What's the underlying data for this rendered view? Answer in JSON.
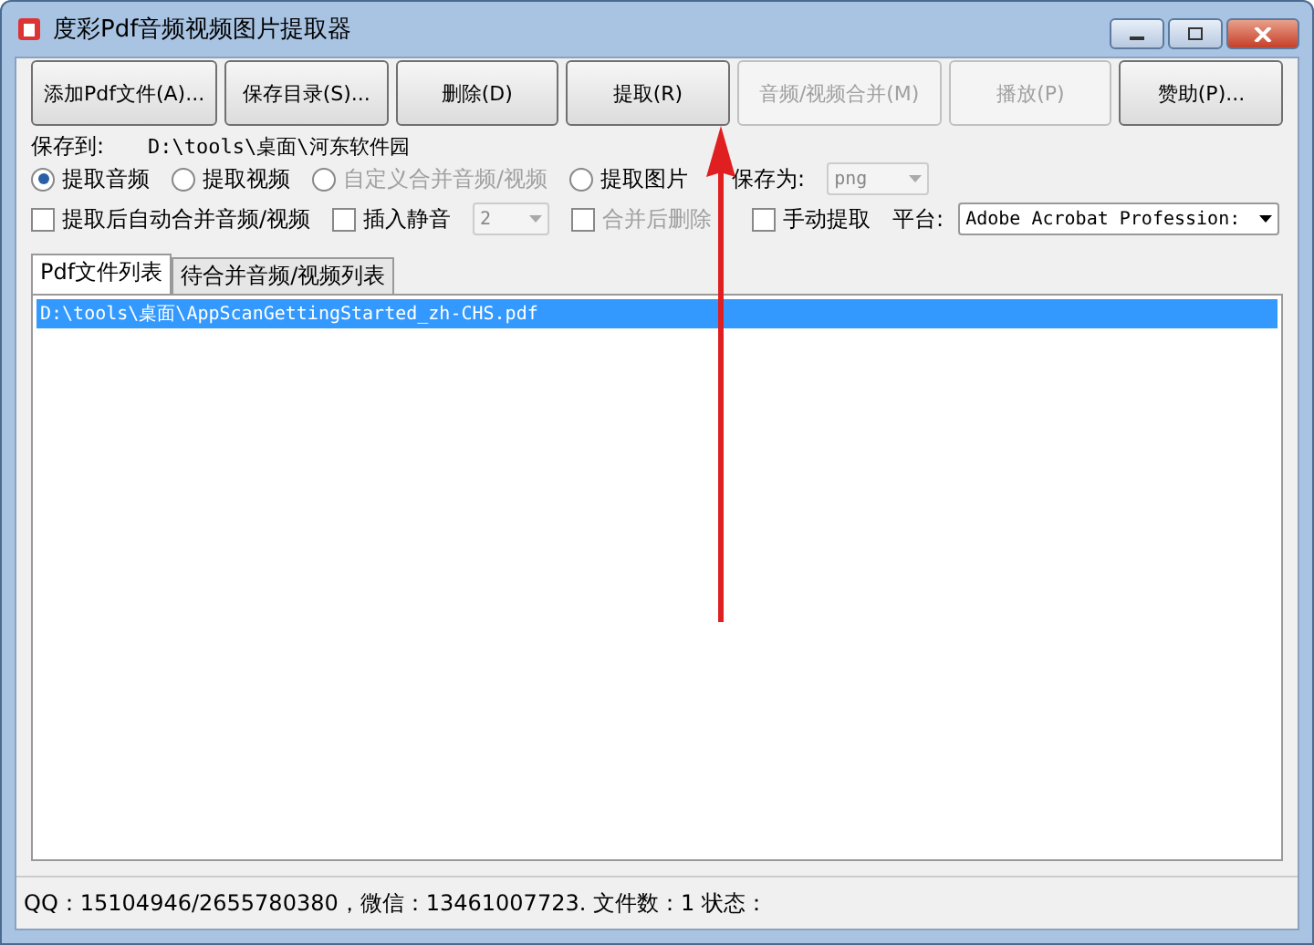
{
  "window": {
    "title": "度彩Pdf音频视频图片提取器"
  },
  "toolbar": [
    {
      "label": "添加Pdf文件(A)...",
      "disabled": false
    },
    {
      "label": "保存目录(S)...",
      "disabled": false
    },
    {
      "label": "删除(D)",
      "disabled": false
    },
    {
      "label": "提取(R)",
      "disabled": false
    },
    {
      "label": "音频/视频合并(M)",
      "disabled": true
    },
    {
      "label": "播放(P)",
      "disabled": true
    },
    {
      "label": "赞助(P)...",
      "disabled": false
    }
  ],
  "save_to": {
    "label": "保存到:",
    "path": "D:\\tools\\桌面\\河东软件园"
  },
  "modes": [
    {
      "label": "提取音频",
      "selected": true,
      "disabled": false
    },
    {
      "label": "提取视频",
      "selected": false,
      "disabled": false
    },
    {
      "label": "自定义合并音频/视频",
      "selected": false,
      "disabled": true
    },
    {
      "label": "提取图片",
      "selected": false,
      "disabled": false
    }
  ],
  "save_as": {
    "label": "保存为:",
    "value": "png",
    "disabled": true
  },
  "options": [
    {
      "kind": "checkbox",
      "label": "提取后自动合并音频/视频",
      "checked": false,
      "disabled": false
    },
    {
      "kind": "checkbox",
      "label": "插入静音",
      "checked": false,
      "disabled": false
    },
    {
      "kind": "select",
      "value": "2",
      "disabled": true
    },
    {
      "kind": "checkbox",
      "label": "合并后删除",
      "checked": false,
      "disabled": true
    },
    {
      "kind": "checkbox",
      "label": "手动提取",
      "checked": false,
      "disabled": false
    }
  ],
  "platform": {
    "label": "平台:",
    "value": "Adobe Acrobat Profession:"
  },
  "tabs": [
    {
      "label": "Pdf文件列表",
      "selected": true
    },
    {
      "label": "待合并音频/视频列表",
      "selected": false
    }
  ],
  "files": [
    {
      "path": "D:\\tools\\桌面\\AppScanGettingStarted_zh-CHS.pdf",
      "selected": true
    }
  ],
  "status_bar": "QQ：15104946/2655780380，微信：13461007723. 文件数：1  状态：",
  "annotation": {
    "kind": "arrow"
  }
}
